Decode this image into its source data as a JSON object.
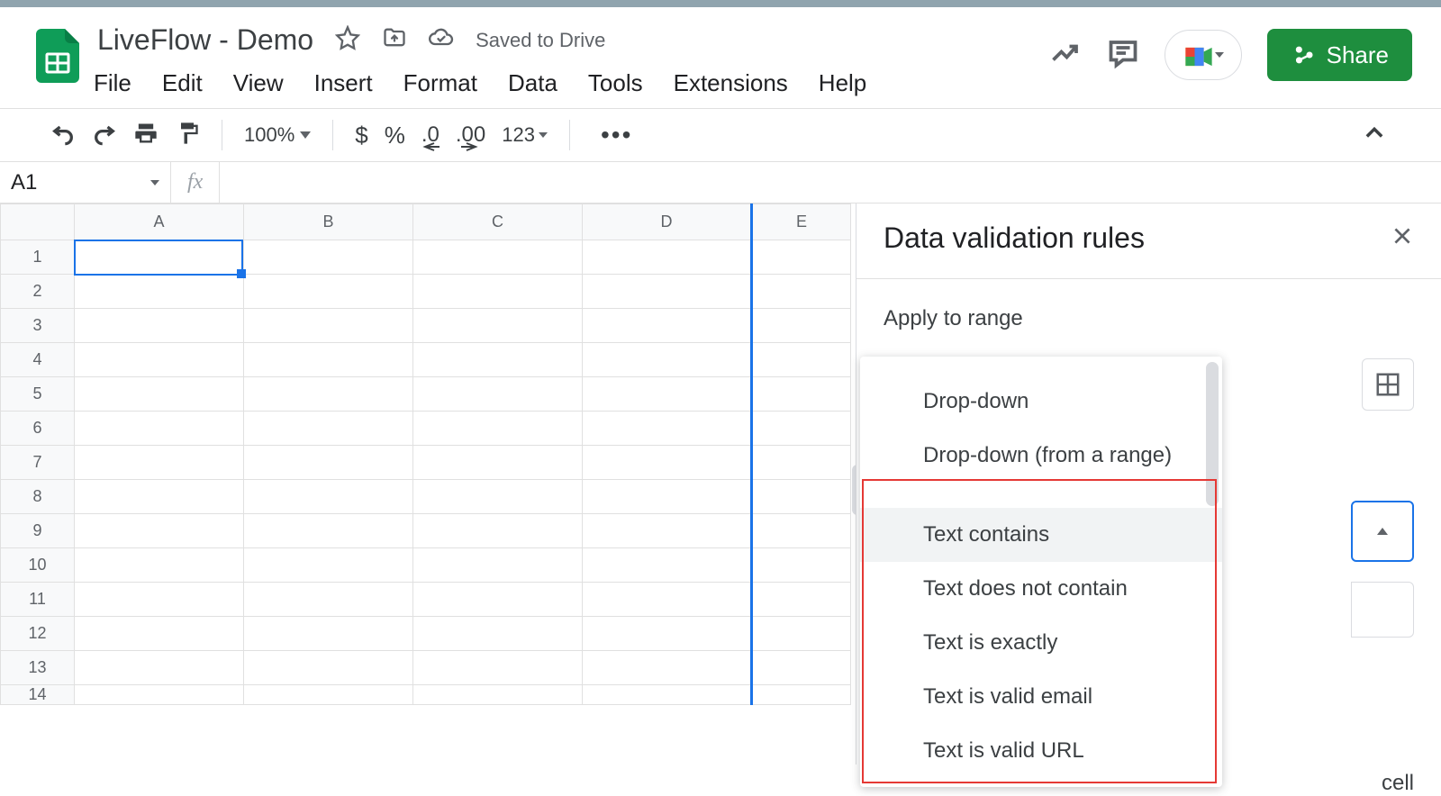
{
  "doc_title": "LiveFlow - Demo",
  "saved_status": "Saved to Drive",
  "menus": [
    "File",
    "Edit",
    "View",
    "Insert",
    "Format",
    "Data",
    "Tools",
    "Extensions",
    "Help"
  ],
  "share_label": "Share",
  "toolbar": {
    "zoom": "100%",
    "currency": "$",
    "percent": "%",
    "dec_decrease": ".0",
    "dec_increase": ".00",
    "num_format": "123"
  },
  "name_box": "A1",
  "fx_label": "fx",
  "columns": [
    "A",
    "B",
    "C",
    "D",
    "E"
  ],
  "rows": [
    "1",
    "2",
    "3",
    "4",
    "5",
    "6",
    "7",
    "8",
    "9",
    "10",
    "11",
    "12",
    "13",
    "14"
  ],
  "panel": {
    "title": "Data validation rules",
    "apply_label": "Apply to range",
    "cell_fragment": "cell",
    "options": [
      "Drop-down",
      "Drop-down (from a range)",
      "Text contains",
      "Text does not contain",
      "Text is exactly",
      "Text is valid email",
      "Text is valid URL"
    ],
    "hovered_index": 2
  }
}
